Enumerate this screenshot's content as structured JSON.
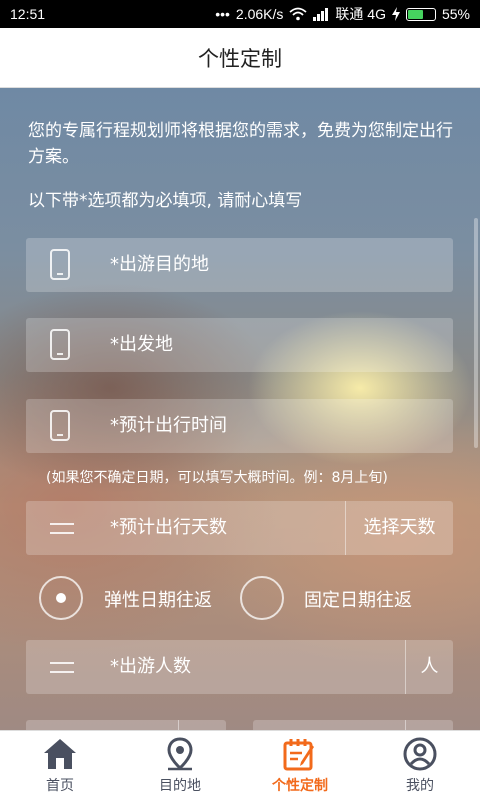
{
  "status_bar": {
    "time": "12:51",
    "dots": "•••",
    "speed": "2.06K/s",
    "carrier": "联通 4G",
    "battery": "55%",
    "battery_color": "#46d35f",
    "icons": [
      "wifi-icon",
      "signal-icon",
      "charging-icon",
      "battery-icon"
    ]
  },
  "header": {
    "title": "个性定制"
  },
  "form": {
    "intro": "您的专属行程规划师将根据您的需求，免费为您制定出行方案。",
    "required_note": "以下带*选项都为必填项, 请耐心填写",
    "destination_label": "*出游目的地",
    "departure_label": "*出发地",
    "travel_time_label": "*预计出行时间",
    "date_hint": "(如果您不确定日期，可以填写大概时间。例：8月上旬)",
    "days_label": "*预计出行天数",
    "days_action": "选择天数",
    "trip_options": [
      {
        "label": "弹性日期往返",
        "selected": true
      },
      {
        "label": "固定日期往返",
        "selected": false
      }
    ],
    "people_label": "*出游人数",
    "people_unit": "人"
  },
  "tabbar": {
    "accent_color": "#f26a1b",
    "items": [
      {
        "label": "首页",
        "icon": "home-icon",
        "active": false
      },
      {
        "label": "目的地",
        "icon": "location-pin-icon",
        "active": false
      },
      {
        "label": "个性定制",
        "icon": "custom-edit-icon",
        "active": true
      },
      {
        "label": "我的",
        "icon": "user-icon",
        "active": false
      }
    ]
  }
}
